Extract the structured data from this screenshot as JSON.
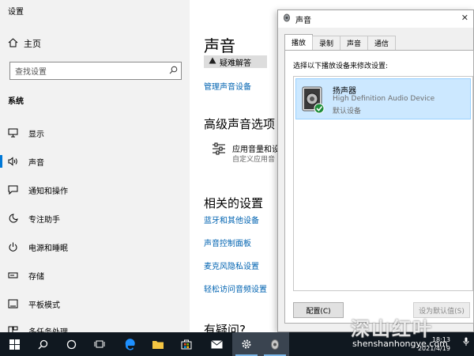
{
  "settings": {
    "window_title": "设置",
    "home_label": "主页",
    "search_placeholder": "查找设置",
    "group_label": "系统",
    "nav_items": [
      {
        "label": "显示",
        "icon": "monitor-icon"
      },
      {
        "label": "声音",
        "icon": "speaker-icon"
      },
      {
        "label": "通知和操作",
        "icon": "notification-icon"
      },
      {
        "label": "专注助手",
        "icon": "moon-icon"
      },
      {
        "label": "电源和睡眠",
        "icon": "power-icon"
      },
      {
        "label": "存储",
        "icon": "storage-icon"
      },
      {
        "label": "平板模式",
        "icon": "tablet-icon"
      },
      {
        "label": "多任务处理",
        "icon": "multitask-icon"
      }
    ],
    "active_index": 1,
    "page_title": "声音",
    "troubleshoot_label": "疑难解答",
    "manage_devices_link": "管理声音设备",
    "advanced_heading": "高级声音选项",
    "app_volume_title": "应用音量和设",
    "app_volume_sub": "自定义应用音",
    "related_heading": "相关的设置",
    "related_links": [
      "蓝牙和其他设备",
      "声音控制面板",
      "麦克风隐私设置",
      "轻松访问音频设置"
    ],
    "questions_heading": "有疑问?"
  },
  "dialog": {
    "title": "声音",
    "tabs": [
      "播放",
      "录制",
      "声音",
      "通信"
    ],
    "active_tab": 0,
    "instruction": "选择以下播放设备来修改设置:",
    "device": {
      "name": "扬声器",
      "description": "High Definition Audio Device",
      "status": "默认设备"
    },
    "configure_button": "配置(C)",
    "set_default_button": "设为默认值(S)"
  },
  "taskbar": {
    "icons": [
      "windows-start-icon",
      "search-icon",
      "cortana-icon",
      "task-view-icon",
      "edge-icon",
      "file-explorer-icon",
      "store-icon",
      "mail-icon",
      "settings-icon",
      "sound-app-icon"
    ],
    "time": "18:13",
    "date": "2021/4/19"
  },
  "watermark": {
    "text": "深山红叶",
    "url": "shenshanhongye.com"
  },
  "colors": {
    "accent": "#0078d7",
    "link": "#0063b1",
    "selection": "#cce8ff",
    "taskbar": "#101820"
  }
}
